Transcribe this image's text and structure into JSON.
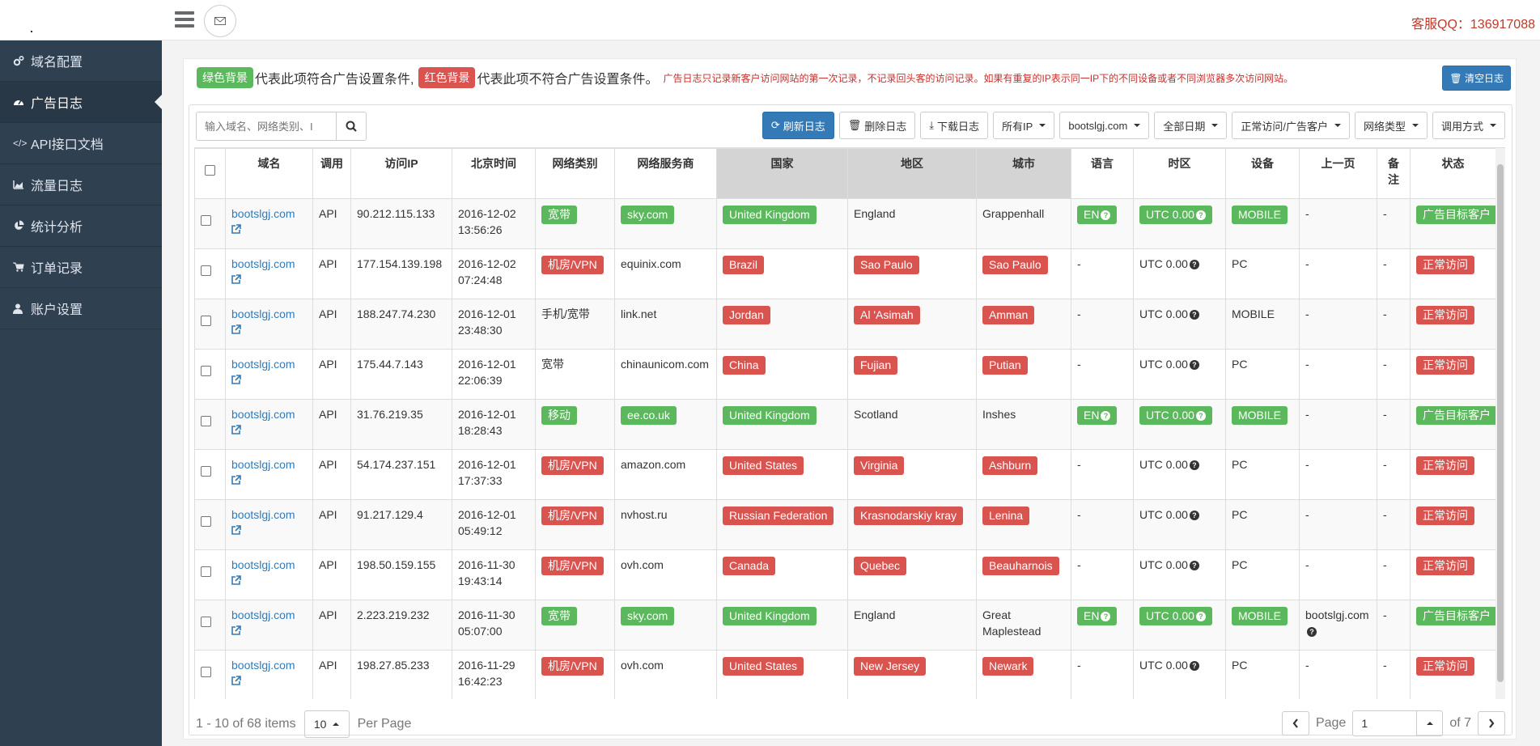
{
  "header": {
    "service_qq": "客服QQ：136917088"
  },
  "sidebar": {
    "items": [
      {
        "label": "域名配置",
        "icon": "gears-icon"
      },
      {
        "label": "广告日志",
        "icon": "dashboard-icon"
      },
      {
        "label": "API接口文档",
        "icon": "code-icon"
      },
      {
        "label": "流量日志",
        "icon": "area-chart-icon"
      },
      {
        "label": "统计分析",
        "icon": "pie-chart-icon"
      },
      {
        "label": "订单记录",
        "icon": "cart-icon"
      },
      {
        "label": "账户设置",
        "icon": "user-icon"
      }
    ]
  },
  "notice": {
    "green_label": "绿色背景",
    "green_text": "代表此项符合广告设置条件,",
    "red_label": "红色背景",
    "red_text": "代表此项不符合广告设置条件。",
    "small_text": "广告日志只记录新客户访问网站的第一次记录，不记录回头客的访问记录。如果有重复的IP表示同一IP下的不同设备或者不同浏览器多次访问网站。",
    "clear_button": "清空日志"
  },
  "search": {
    "placeholder": "输入域名、网络类别、I"
  },
  "toolbar": {
    "refresh": "刷新日志",
    "delete": "删除日志",
    "download": "下载日志",
    "ip_filter": "所有IP",
    "domain_filter": "bootslgj.com",
    "date_filter": "全部日期",
    "visit_filter": "正常访问/广告客户",
    "net_filter": "网络类型",
    "call_filter": "调用方式"
  },
  "table": {
    "headers": [
      "域名",
      "调用",
      "访问IP",
      "北京时间",
      "网络类别",
      "网络服务商",
      "国家",
      "地区",
      "城市",
      "语言",
      "时区",
      "设备",
      "上一页",
      "备注",
      "状态"
    ],
    "rows": [
      {
        "domain": "bootslgj.com",
        "call": "API",
        "ip": "90.212.115.133",
        "date": "2016-12-02",
        "time": "13:56:26",
        "net": "宽带",
        "net_c": "g",
        "isp": "sky.com",
        "isp_c": "g",
        "country": "United Kingdom",
        "country_c": "g",
        "region": "England",
        "region_c": "",
        "city": "Grappenhall",
        "city_c": "",
        "lang": "EN",
        "lang_c": "g",
        "tz": "UTC 0.00",
        "tz_c": "g",
        "device": "MOBILE",
        "device_c": "g",
        "prev": "-",
        "note": "-",
        "status": "广告目标客户",
        "status_c": "g"
      },
      {
        "domain": "bootslgj.com",
        "call": "API",
        "ip": "177.154.139.198",
        "date": "2016-12-02",
        "time": "07:24:48",
        "net": "机房/VPN",
        "net_c": "r",
        "isp": "equinix.com",
        "isp_c": "",
        "country": "Brazil",
        "country_c": "r",
        "region": "Sao Paulo",
        "region_c": "r",
        "city": "Sao Paulo",
        "city_c": "r",
        "lang": "-",
        "lang_c": "",
        "tz": "UTC 0.00",
        "tz_c": "",
        "device": "PC",
        "device_c": "",
        "prev": "-",
        "note": "-",
        "status": "正常访问",
        "status_c": "r"
      },
      {
        "domain": "bootslgj.com",
        "call": "API",
        "ip": "188.247.74.230",
        "date": "2016-12-01",
        "time": "23:48:30",
        "net": "手机/宽带",
        "net_c": "",
        "isp": "link.net",
        "isp_c": "",
        "country": "Jordan",
        "country_c": "r",
        "region": "Al 'Asimah",
        "region_c": "r",
        "city": "Amman",
        "city_c": "r",
        "lang": "-",
        "lang_c": "",
        "tz": "UTC 0.00",
        "tz_c": "",
        "device": "MOBILE",
        "device_c": "",
        "prev": "-",
        "note": "-",
        "status": "正常访问",
        "status_c": "r"
      },
      {
        "domain": "bootslgj.com",
        "call": "API",
        "ip": "175.44.7.143",
        "date": "2016-12-01",
        "time": "22:06:39",
        "net": "宽带",
        "net_c": "",
        "isp": "chinaunicom.com",
        "isp_c": "",
        "country": "China",
        "country_c": "r",
        "region": "Fujian",
        "region_c": "r",
        "city": "Putian",
        "city_c": "r",
        "lang": "-",
        "lang_c": "",
        "tz": "UTC 0.00",
        "tz_c": "",
        "device": "PC",
        "device_c": "",
        "prev": "-",
        "note": "-",
        "status": "正常访问",
        "status_c": "r"
      },
      {
        "domain": "bootslgj.com",
        "call": "API",
        "ip": "31.76.219.35",
        "date": "2016-12-01",
        "time": "18:28:43",
        "net": "移动",
        "net_c": "g",
        "isp": "ee.co.uk",
        "isp_c": "g",
        "country": "United Kingdom",
        "country_c": "g",
        "region": "Scotland",
        "region_c": "",
        "city": "Inshes",
        "city_c": "",
        "lang": "EN",
        "lang_c": "g",
        "tz": "UTC 0.00",
        "tz_c": "g",
        "device": "MOBILE",
        "device_c": "g",
        "prev": "-",
        "note": "-",
        "status": "广告目标客户",
        "status_c": "g"
      },
      {
        "domain": "bootslgj.com",
        "call": "API",
        "ip": "54.174.237.151",
        "date": "2016-12-01",
        "time": "17:37:33",
        "net": "机房/VPN",
        "net_c": "r",
        "isp": "amazon.com",
        "isp_c": "",
        "country": "United States",
        "country_c": "r",
        "region": "Virginia",
        "region_c": "r",
        "city": "Ashburn",
        "city_c": "r",
        "lang": "-",
        "lang_c": "",
        "tz": "UTC 0.00",
        "tz_c": "",
        "device": "PC",
        "device_c": "",
        "prev": "-",
        "note": "-",
        "status": "正常访问",
        "status_c": "r"
      },
      {
        "domain": "bootslgj.com",
        "call": "API",
        "ip": "91.217.129.4",
        "date": "2016-12-01",
        "time": "05:49:12",
        "net": "机房/VPN",
        "net_c": "r",
        "isp": "nvhost.ru",
        "isp_c": "",
        "country": "Russian Federation",
        "country_c": "r",
        "region": "Krasnodarskiy kray",
        "region_c": "r",
        "city": "Lenina",
        "city_c": "r",
        "lang": "-",
        "lang_c": "",
        "tz": "UTC 0.00",
        "tz_c": "",
        "device": "PC",
        "device_c": "",
        "prev": "-",
        "note": "-",
        "status": "正常访问",
        "status_c": "r"
      },
      {
        "domain": "bootslgj.com",
        "call": "API",
        "ip": "198.50.159.155",
        "date": "2016-11-30",
        "time": "19:43:14",
        "net": "机房/VPN",
        "net_c": "r",
        "isp": "ovh.com",
        "isp_c": "",
        "country": "Canada",
        "country_c": "r",
        "region": "Quebec",
        "region_c": "r",
        "city": "Beauharnois",
        "city_c": "r",
        "lang": "-",
        "lang_c": "",
        "tz": "UTC 0.00",
        "tz_c": "",
        "device": "PC",
        "device_c": "",
        "prev": "-",
        "note": "-",
        "status": "正常访问",
        "status_c": "r"
      },
      {
        "domain": "bootslgj.com",
        "call": "API",
        "ip": "2.223.219.232",
        "date": "2016-11-30",
        "time": "05:07:00",
        "net": "宽带",
        "net_c": "g",
        "isp": "sky.com",
        "isp_c": "g",
        "country": "United Kingdom",
        "country_c": "g",
        "region": "England",
        "region_c": "",
        "city": "Great Maplestead",
        "city_c": "",
        "lang": "EN",
        "lang_c": "g",
        "tz": "UTC 0.00",
        "tz_c": "g",
        "device": "MOBILE",
        "device_c": "g",
        "prev": "bootslgj.com",
        "prev_q": true,
        "note": "-",
        "status": "广告目标客户",
        "status_c": "g"
      },
      {
        "domain": "bootslgj.com",
        "call": "API",
        "ip": "198.27.85.233",
        "date": "2016-11-29",
        "time": "16:42:23",
        "net": "机房/VPN",
        "net_c": "r",
        "isp": "ovh.com",
        "isp_c": "",
        "country": "United States",
        "country_c": "r",
        "region": "New Jersey",
        "region_c": "r",
        "city": "Newark",
        "city_c": "r",
        "lang": "-",
        "lang_c": "",
        "tz": "UTC 0.00",
        "tz_c": "",
        "device": "PC",
        "device_c": "",
        "prev": "-",
        "note": "-",
        "status": "正常访问",
        "status_c": "r"
      }
    ]
  },
  "pagination": {
    "summary": "1 - 10 of 68 items",
    "page_size": "10",
    "per_page": "Per Page",
    "page_label": "Page",
    "current_page": "1",
    "of_total": "of 7"
  },
  "colors": {
    "green": "#5cb85c",
    "red": "#d9534f",
    "sidebar": "#2f4050",
    "primary": "#337ab7"
  }
}
